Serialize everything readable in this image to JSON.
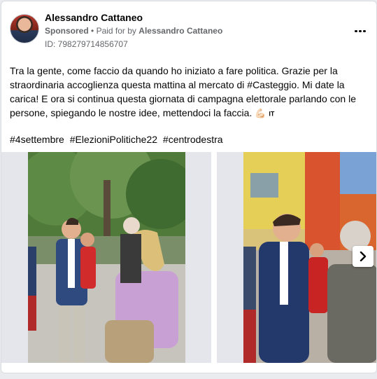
{
  "header": {
    "name": "Alessandro Cattaneo",
    "sponsored": "Sponsored",
    "separator": "•",
    "paid_prefix": "Paid for by",
    "paid_by": "Alessandro Cattaneo",
    "ad_id": "ID: 798279714856707"
  },
  "post": {
    "text": "Tra la gente, come faccio da quando ho iniziato a fare politica. Grazie per la straordinaria accoglienza questa mattina al mercato di #Casteggio. Mi date la carica! E ora si continua questa giornata di campagna elettorale parlando con le persone, spiegando le nostre idee, mettendoci la faccia.",
    "emoji": "💪🏻",
    "flag": "IT",
    "hashtags": [
      "#4settembre",
      "#ElezioniPolitiche22",
      "#centrodestra"
    ]
  },
  "icons": {
    "more": "more-options-icon",
    "next": "chevron-right-icon"
  },
  "colors": {
    "text": "#050505",
    "secondary": "#65676b",
    "background": "#e9ebee"
  }
}
